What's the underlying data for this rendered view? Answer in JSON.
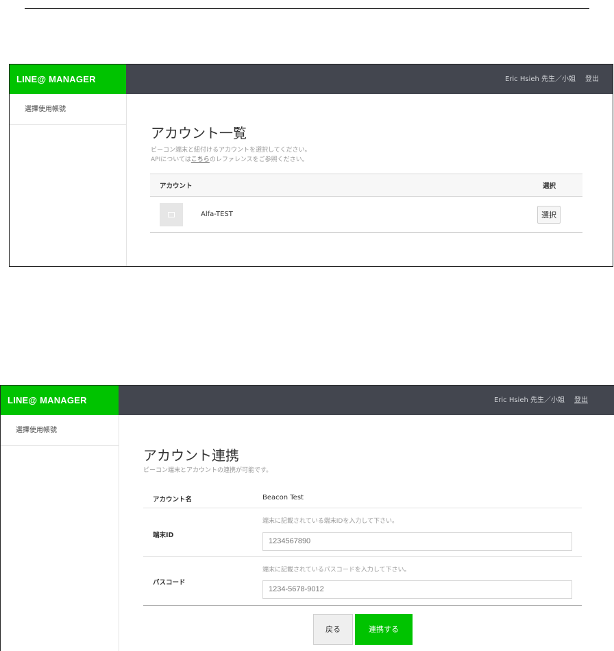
{
  "screen1": {
    "header": {
      "logo": "LINE@ MANAGER",
      "user": "Eric Hsieh 先生／小姐",
      "logout": "登出"
    },
    "sidebar": {
      "items": [
        {
          "label": "選擇使用帳號"
        }
      ]
    },
    "main": {
      "title": "アカウント一覧",
      "desc_line1": "ビーコン端末と紐付けるアカウントを選択してください。",
      "desc_line2_prefix": "APIについては",
      "desc_line2_link": "こちら",
      "desc_line2_suffix": "のレファレンスをご参照ください。",
      "table": {
        "headers": {
          "account": "アカウント",
          "select": "選択"
        },
        "rows": [
          {
            "name": "Alfa-TEST",
            "button": "選択"
          }
        ]
      }
    }
  },
  "screen2": {
    "header": {
      "logo": "LINE@ MANAGER",
      "user": "Eric Hsieh 先生／小姐",
      "logout": "登出"
    },
    "sidebar": {
      "items": [
        {
          "label": "選擇使用帳號"
        }
      ]
    },
    "main": {
      "title": "アカウント連携",
      "desc": "ビーコン端末とアカウントの連携が可能です。",
      "form": {
        "account_name_label": "アカウント名",
        "account_name_value": "Beacon Test",
        "device_id_label": "端末ID",
        "device_id_hint": "端末に記載されている端末IDを入力して下さい。",
        "device_id_value": "1234567890",
        "passcode_label": "パスコード",
        "passcode_hint": "端末に記載されているパスコードを入力して下さい。",
        "passcode_value": "1234-5678-9012"
      },
      "buttons": {
        "back": "戻る",
        "link": "連携する"
      }
    }
  },
  "colors": {
    "brand_green": "#00c300",
    "header_bg": "#43464f"
  },
  "icons": {
    "thumbnail": "image-placeholder-icon"
  }
}
